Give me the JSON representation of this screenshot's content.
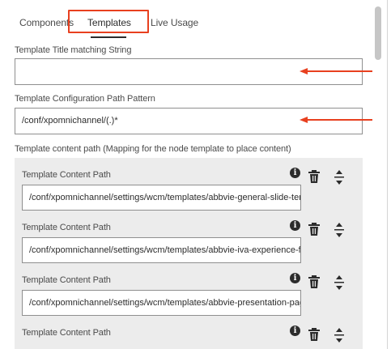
{
  "tabs": [
    {
      "label": "Components"
    },
    {
      "label": "Templates"
    },
    {
      "label": "Live Usage"
    }
  ],
  "fields": {
    "title_matching": {
      "label": "Template Title matching String",
      "value": ""
    },
    "config_path": {
      "label": "Template Configuration Path Pattern",
      "value": "/conf/xpomnichannel/(.)*"
    },
    "content_path_section": {
      "label": "Template content path (Mapping for the node template to place content)"
    }
  },
  "multifield_items": [
    {
      "label": "Template Content Path",
      "value": "/conf/xpomnichannel/settings/wcm/templates/abbvie-general-slide-ter"
    },
    {
      "label": "Template Content Path",
      "value": "/conf/xpomnichannel/settings/wcm/templates/abbvie-iva-experience-fr"
    },
    {
      "label": "Template Content Path",
      "value": "/conf/xpomnichannel/settings/wcm/templates/abbvie-presentation-pag"
    },
    {
      "label": "Template Content Path",
      "value": ""
    }
  ],
  "icons": {
    "info": "info-icon",
    "info_glyph": "i",
    "delete": "trash-icon",
    "reorder": "move-icon"
  },
  "colors": {
    "annotation": "#e8401f",
    "multifield_bg": "#ececec"
  }
}
